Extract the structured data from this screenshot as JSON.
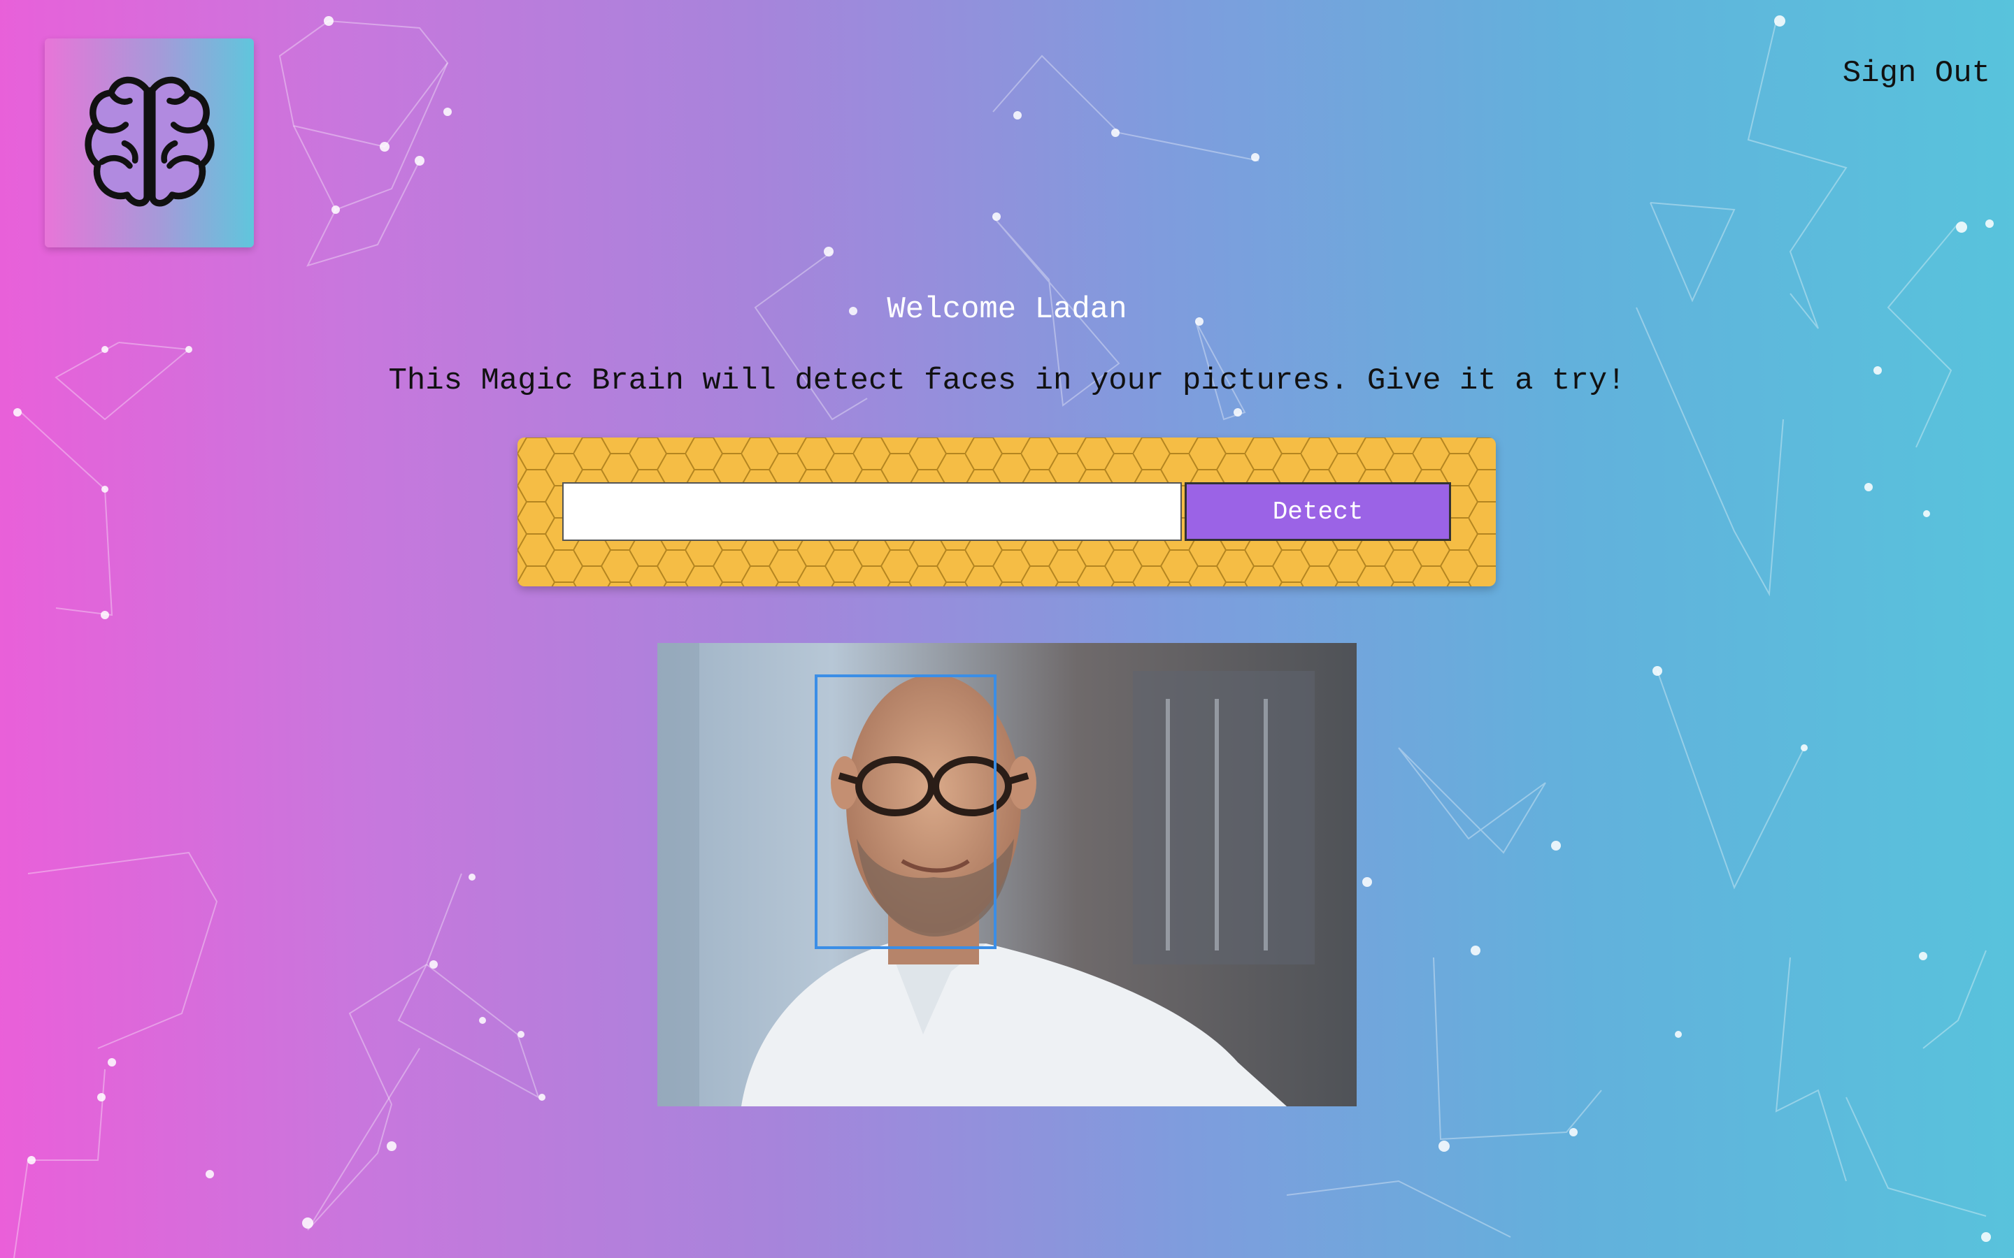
{
  "header": {
    "logo_icon": "brain-icon",
    "sign_out_label": "Sign Out"
  },
  "main": {
    "welcome_text": "Welcome Ladan",
    "tagline": "This Magic Brain will detect faces in your pictures. Give it a try!",
    "image_url_input": {
      "value": "",
      "placeholder": ""
    },
    "detect_label": "Detect"
  },
  "colors": {
    "gradient_left": "#ea5fd9",
    "gradient_right": "#58c3dc",
    "form_panel": "#f5bd45",
    "detect_button": "#9b63e6",
    "face_box": "#3b8ee6"
  }
}
